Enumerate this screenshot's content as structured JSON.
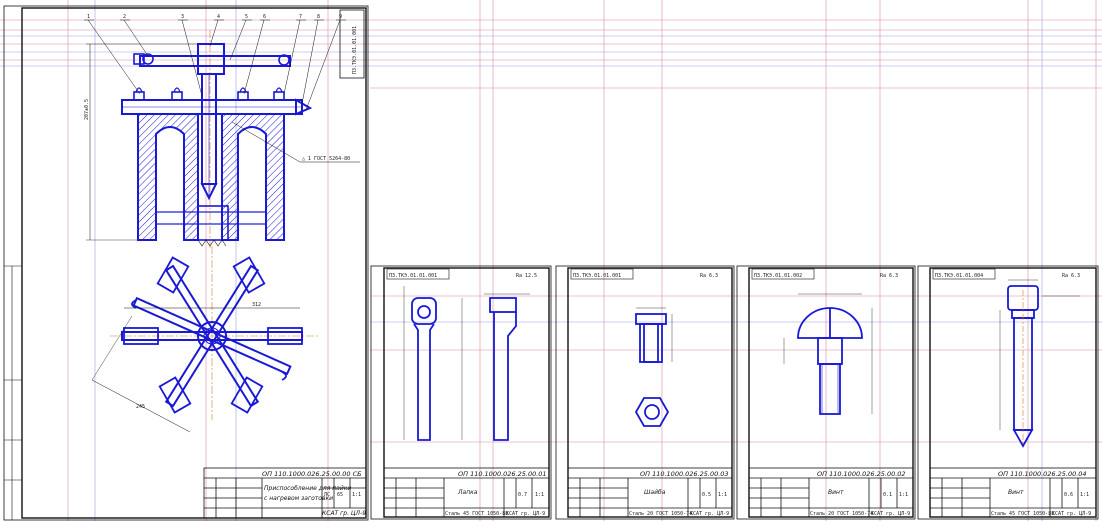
{
  "assembly": {
    "balloons": [
      "1",
      "2",
      "3",
      "4",
      "5",
      "6",
      "7",
      "8",
      "9"
    ],
    "dim_height": "207±0.5",
    "dim_width": "312",
    "dim_diag": "245",
    "weld_note": "△ 1 ГОСТ 5264-80",
    "vertical_title": "ПЗ.ТКЭ.01.01.001",
    "titleblock": {
      "code": "ОП 110.1000.026.25.00.00 СБ",
      "name_line1": "Приспособление для пайки",
      "name_line2": "с нагревом заготовки",
      "sheet": "ЛС",
      "mass": "65",
      "scale": "1:1",
      "org": "КСАТ гр. ЦЛ-9"
    }
  },
  "sheets": [
    {
      "id": "lever",
      "stamp": "ПЗ.ТКЭ.01.01.001",
      "roughness": "Ra 12.5",
      "code": "ОП 110.1000.026.25.00.01",
      "name": "Лапка",
      "material": "Сталь 45 ГОСТ 1050-88",
      "qty": "0.7",
      "scale": "1:1",
      "org": "КСАТ гр. ЦЛ-9"
    },
    {
      "id": "nut",
      "stamp": "ПЗ.ТКЭ.01.01.001",
      "roughness": "Ra 6.3",
      "code": "ОП 110.1000.026.25.00.03",
      "name": "Шайба",
      "material": "Сталь 20 ГОСТ 1050-74",
      "qty": "0.5",
      "scale": "1:1",
      "org": "КСАТ гр. ЦЛ-9"
    },
    {
      "id": "screw",
      "stamp": "ПЗ.ТКЭ.01.01.002",
      "roughness": "Ra 6.3",
      "code": "ОП 110.1000.026.25.00.02",
      "name": "Винт",
      "material": "Сталь 20 ГОСТ 1050-74",
      "qty": "0.1",
      "scale": "1:1",
      "org": "КСАТ гр. ЦЛ-9"
    },
    {
      "id": "pin",
      "stamp": "ПЗ.ТКЭ.01.01.004",
      "roughness": "Ra 6.3",
      "code": "ОП 110.1000.026.25.00.04",
      "name": "Винт",
      "material": "Сталь 45 ГОСТ 1050-88",
      "qty": "0.6",
      "scale": "1:1",
      "org": "КСАТ гр. ЦЛ-9"
    }
  ]
}
